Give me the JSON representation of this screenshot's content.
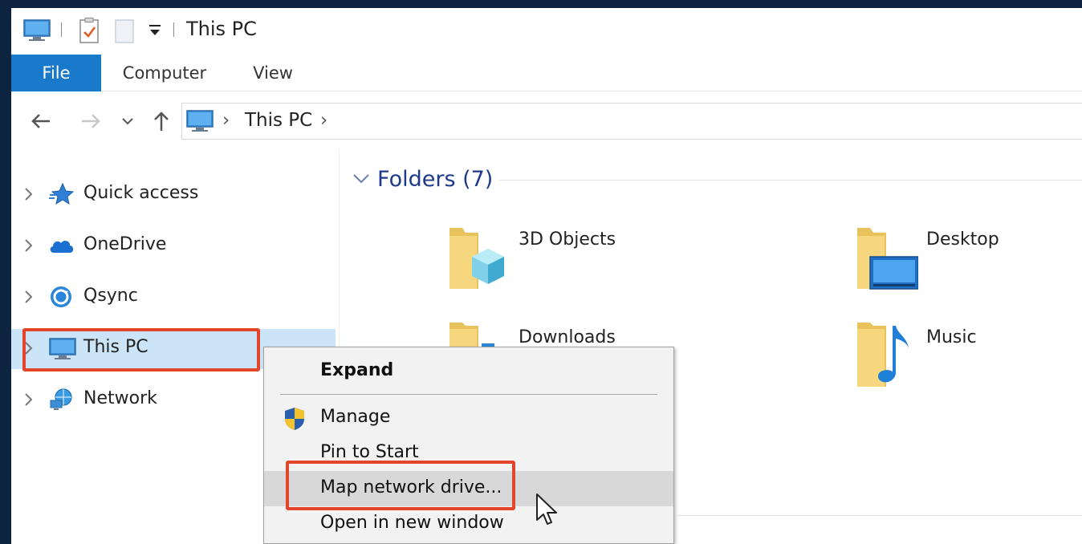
{
  "window": {
    "title": "This PC"
  },
  "ribbon": {
    "tabs": [
      "File",
      "Computer",
      "View"
    ],
    "active_tab": "File",
    "accent_color": "#1979ca"
  },
  "address": {
    "crumbs": [
      "This PC"
    ],
    "separator": "›"
  },
  "sidebar": {
    "items": [
      {
        "label": "Quick access",
        "icon": "star-icon"
      },
      {
        "label": "OneDrive",
        "icon": "cloud-icon"
      },
      {
        "label": "Qsync",
        "icon": "sync-icon"
      },
      {
        "label": "This PC",
        "icon": "computer-icon",
        "selected": true
      },
      {
        "label": "Network",
        "icon": "network-icon"
      }
    ]
  },
  "content": {
    "group_title": "Folders (7)",
    "folders": [
      {
        "label": "3D Objects",
        "icon": "3d-objects-folder-icon"
      },
      {
        "label": "Desktop",
        "icon": "desktop-folder-icon"
      },
      {
        "label": "Downloads",
        "icon": "downloads-folder-icon"
      },
      {
        "label": "Music",
        "icon": "music-folder-icon"
      }
    ]
  },
  "context_menu": {
    "items": [
      {
        "label": "Expand",
        "bold": true
      },
      {
        "label": "Manage",
        "icon": "shield-icon"
      },
      {
        "label": "Pin to Start"
      },
      {
        "label": "Map network drive...",
        "highlighted": true
      },
      {
        "label": "Open in new window"
      }
    ]
  },
  "highlight_color": "#e2442c",
  "selection_color": "#cce4f7"
}
